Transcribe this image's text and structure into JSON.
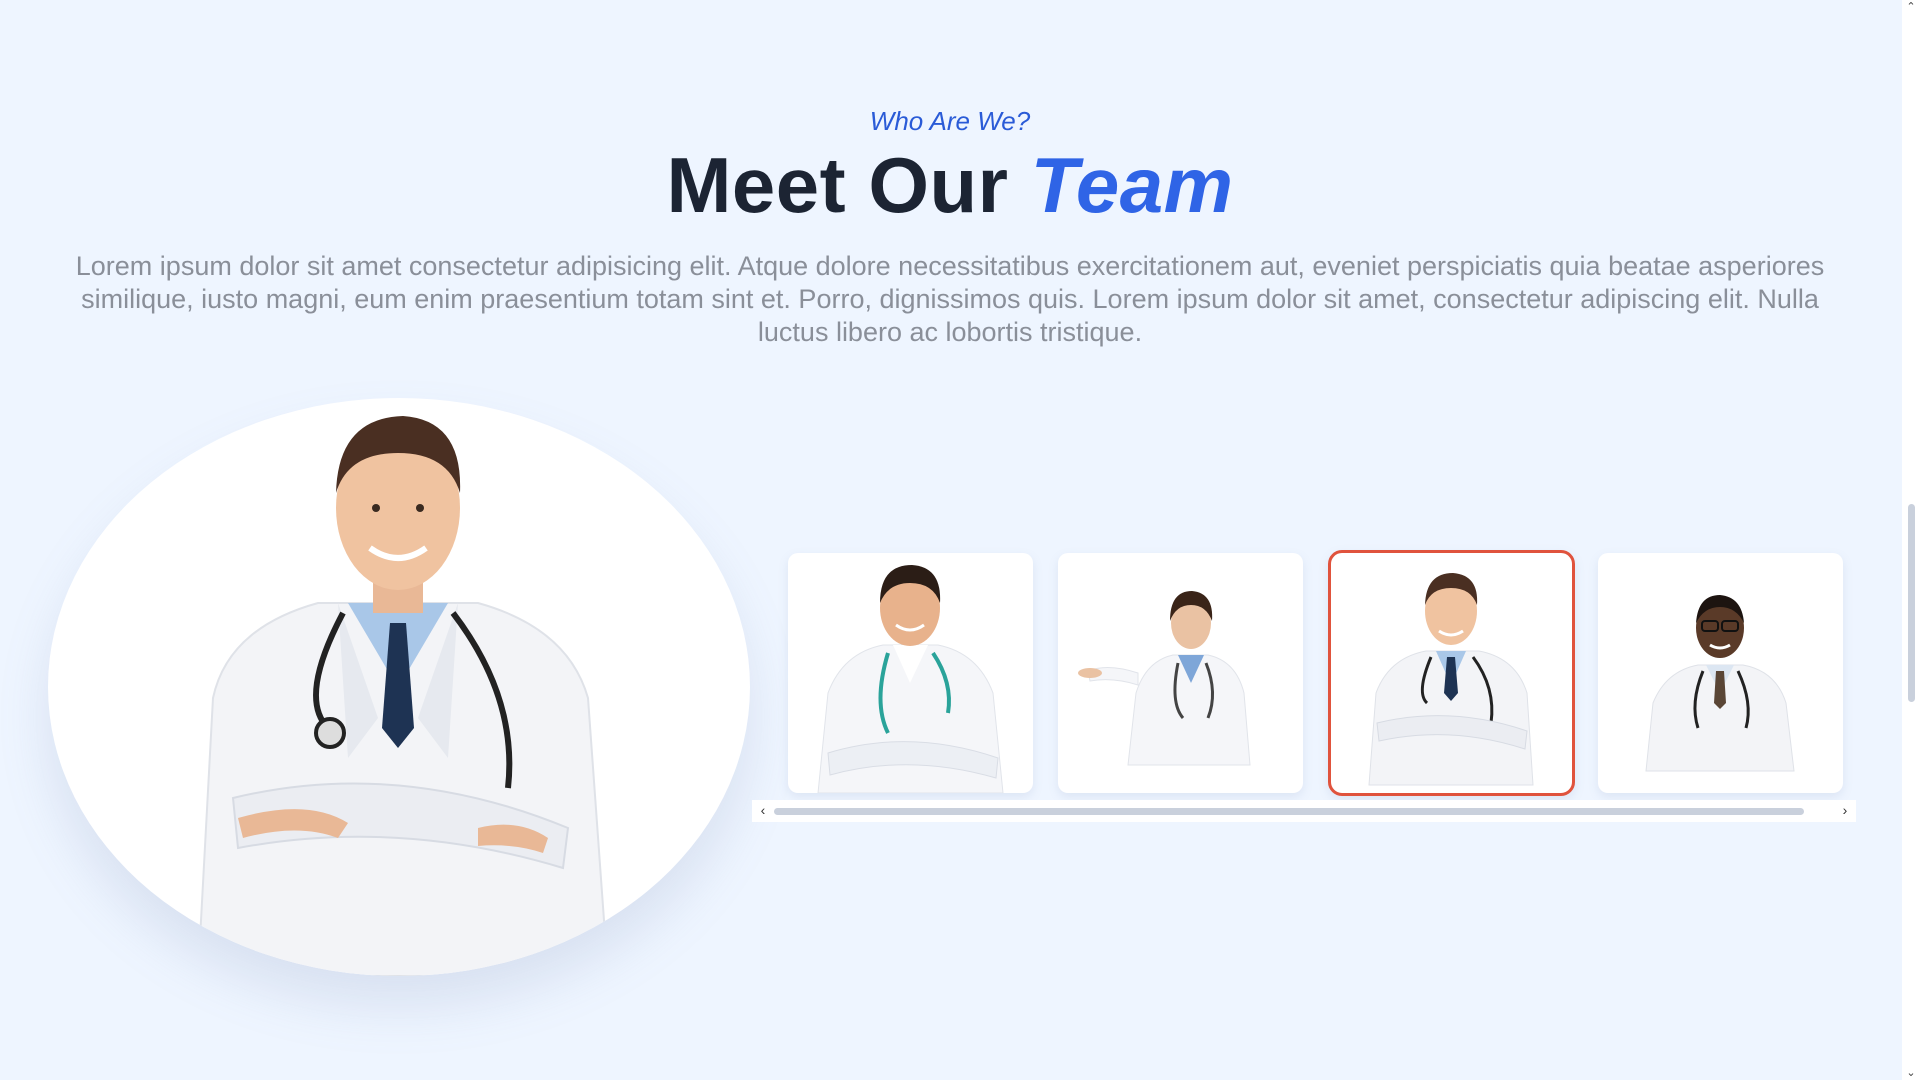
{
  "section": {
    "eyebrow": "Who Are We?",
    "title_main": "Meet Our ",
    "title_accent": "Team",
    "intro": "Lorem ipsum dolor sit amet consectetur adipisicing elit. Atque dolore necessitatibus exercitationem aut, eveniet perspiciatis quia beatae asperiores similique, iusto magni, eum enim praesentium totam sint et. Porro, dignissimos quis. Lorem ipsum dolor sit amet, consectetur adipiscing elit. Nulla luctus libero ac lobortis tristique."
  },
  "featured": {
    "image": "doctor-man-crossed-arms-stethoscope"
  },
  "team": {
    "selected_index": 2,
    "members": [
      {
        "image": "doctor-man-smiling-teal-stethoscope"
      },
      {
        "image": "doctor-woman-presenting-gesture"
      },
      {
        "image": "doctor-man-crossed-arms-stethoscope"
      },
      {
        "image": "doctor-man-glasses-stethoscope"
      }
    ]
  },
  "scrollbars": {
    "left_arrow": "‹",
    "right_arrow": "›",
    "up_arrow": "⌃",
    "down_arrow": "⌄"
  },
  "colors": {
    "background": "#eef5ff",
    "accent": "#2f64e6",
    "heading": "#1c2433",
    "body_text": "#8a8f99",
    "selected_border": "#e0533d"
  }
}
